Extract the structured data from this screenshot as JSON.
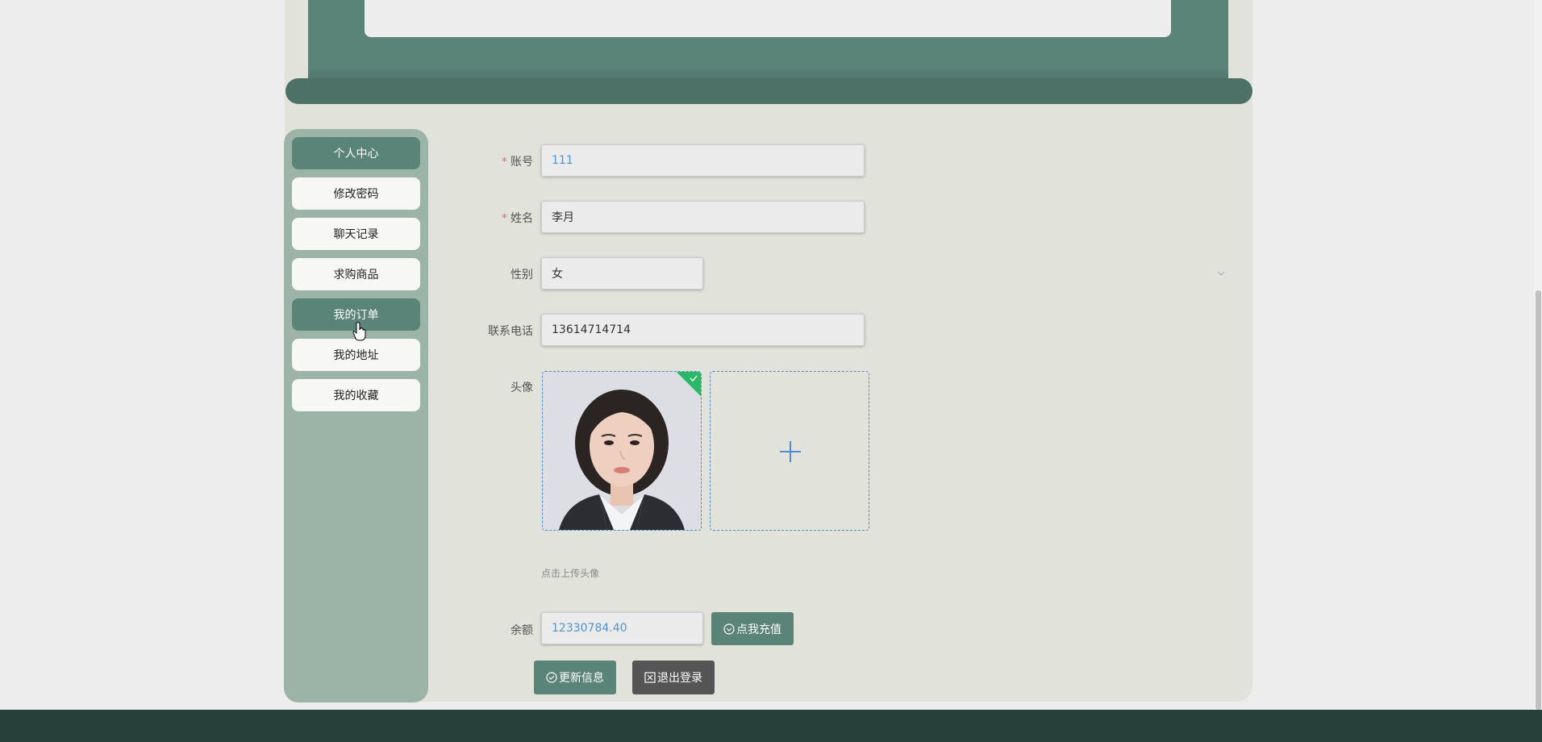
{
  "sidebar": {
    "items": [
      {
        "label": "个人中心",
        "active": true
      },
      {
        "label": "修改密码",
        "active": false
      },
      {
        "label": "聊天记录",
        "active": false
      },
      {
        "label": "求购商品",
        "active": false
      },
      {
        "label": "我的订单",
        "active": true
      },
      {
        "label": "我的地址",
        "active": false
      },
      {
        "label": "我的收藏",
        "active": false
      }
    ]
  },
  "form": {
    "account_label": "账号",
    "account_value": "111",
    "name_label": "姓名",
    "name_value": "李月",
    "gender_label": "性别",
    "gender_value": "女",
    "phone_label": "联系电话",
    "phone_value": "13614714714",
    "avatar_label": "头像",
    "avatar_hint": "点击上传头像",
    "balance_label": "余额",
    "balance_value": "12330784.40",
    "required_mark": "*"
  },
  "buttons": {
    "recharge": "点我充值",
    "update": "更新信息",
    "logout": "退出登录"
  },
  "colors": {
    "accent": "#5b8479",
    "sidebar_bg": "#9cb3a7",
    "panel_bg": "#e1e3da",
    "footer_bg": "#27413a",
    "logout_bg": "#555555"
  }
}
